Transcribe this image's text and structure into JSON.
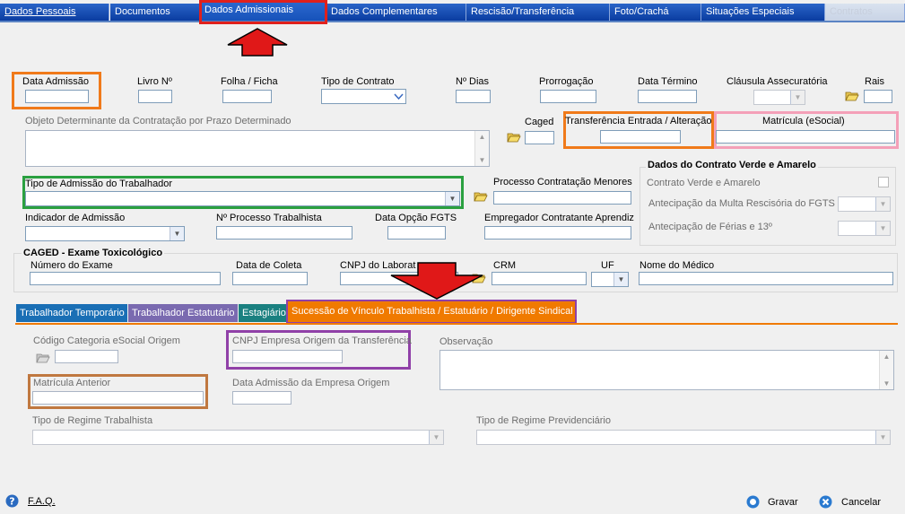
{
  "top_tabs": [
    {
      "label": "Dados Pessoais"
    },
    {
      "label": "Documentos"
    },
    {
      "label": "Dados Admissionais"
    },
    {
      "label": "Dados Complementares"
    },
    {
      "label": "Rescisão/Transferência"
    },
    {
      "label": "Foto/Crachá"
    },
    {
      "label": "Situações Especiais"
    },
    {
      "label": "Contratos"
    }
  ],
  "fields": {
    "data_admissao": "Data Admissão",
    "livro": "Livro Nº",
    "folha": "Folha / Ficha",
    "tipo_contrato": "Tipo de Contrato",
    "dias": "Nº Dias",
    "prorrogacao": "Prorrogação",
    "data_termino": "Data Término",
    "clausula": "Cláusula Assecuratória",
    "rais": "Rais",
    "objeto": "Objeto Determinante da Contratação por Prazo Determinado",
    "caged": "Caged",
    "transferencia": "Transferência Entrada / Alteração",
    "matricula": "Matrícula (eSocial)",
    "tipo_admissao": "Tipo de Admissão do Trabalhador",
    "processo_menores": "Processo Contratação Menores",
    "indicador": "Indicador de Admissão",
    "processo_trab": "Nº Processo Trabalhista",
    "data_opcao": "Data Opção FGTS",
    "empregador": "Empregador Contratante Aprendiz"
  },
  "verde_amarelo": {
    "title": "Dados do Contrato Verde e Amarelo",
    "contrato": "Contrato Verde e Amarelo",
    "multa": "Antecipação da Multa Rescisória do FGTS",
    "ferias": "Antecipação de Férias e 13º"
  },
  "caged_exame": {
    "title": "CAGED - Exame Toxicológico",
    "numero": "Número do Exame",
    "data_coleta": "Data de Coleta",
    "cnpj": "CNPJ do Laborat",
    "crm": "CRM",
    "uf": "UF",
    "medico": "Nome do Médico"
  },
  "bottom_tabs": [
    {
      "label": "Trabalhador Temporário",
      "color": "#1a6fb5"
    },
    {
      "label": "Trabalhador Estatutário",
      "color": "#7a6ab0"
    },
    {
      "label": "Estagiário",
      "color": "#1a8080"
    },
    {
      "label": "Sucessão de Vínculo Trabalhista / Estatuário / Dirigente Sindical",
      "color": "#f07a00"
    }
  ],
  "sucessao": {
    "codigo": "Código Categoria eSocial Origem",
    "cnpj_origem": "CNPJ Empresa Origem da Transferência",
    "observacao": "Observação",
    "matricula_anterior": "Matrícula Anterior",
    "data_adm_origem": "Data Admissão da Empresa Origem",
    "regime_trab": "Tipo de Regime Trabalhista",
    "regime_prev": "Tipo de Regime Previdenciário"
  },
  "footer": {
    "faq": "F.A.Q.",
    "gravar": "Gravar",
    "cancelar": "Cancelar"
  },
  "colors": {
    "highlight_red": "#e0201c",
    "highlight_orange": "#f07a1a",
    "highlight_pink": "#f4a0b8",
    "highlight_green": "#2aa040",
    "highlight_purple": "#9040a8",
    "highlight_brown": "#c07840"
  }
}
